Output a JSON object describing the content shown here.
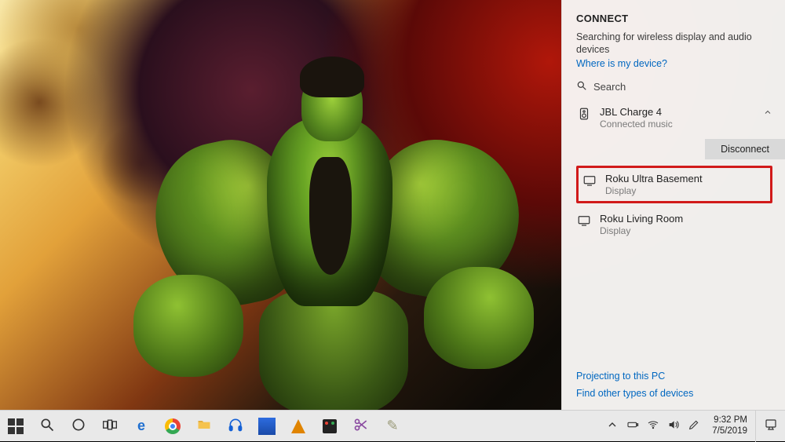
{
  "connect": {
    "title": "CONNECT",
    "status": "Searching for wireless display and audio devices",
    "where_link": "Where is my device?",
    "search_placeholder": "Search",
    "disconnect_label": "Disconnect",
    "devices": [
      {
        "name": "JBL Charge 4",
        "sub": "Connected music",
        "icon": "speaker",
        "expanded": true
      },
      {
        "name": "Roku Ultra Basement",
        "sub": "Display",
        "icon": "display",
        "highlighted": true
      },
      {
        "name": "Roku Living Room",
        "sub": "Display",
        "icon": "display"
      }
    ],
    "footer_links": [
      "Projecting to this PC",
      "Find other types of devices"
    ]
  },
  "taskbar": {
    "left": [
      {
        "name": "start-button",
        "icon": "windows"
      },
      {
        "name": "search-button",
        "icon": "search"
      },
      {
        "name": "cortana-button",
        "icon": "cortana"
      },
      {
        "name": "task-view-button",
        "icon": "taskview"
      },
      {
        "name": "edge-app",
        "icon": "edge"
      },
      {
        "name": "chrome-app",
        "icon": "chrome"
      },
      {
        "name": "explorer-app",
        "icon": "folder"
      },
      {
        "name": "audio-app",
        "icon": "headphones"
      },
      {
        "name": "active-app",
        "icon": "bluewin"
      },
      {
        "name": "vlc-app",
        "icon": "vlc"
      },
      {
        "name": "store-app",
        "icon": "store"
      },
      {
        "name": "snip-app",
        "icon": "snip"
      },
      {
        "name": "misc-app",
        "icon": "misc"
      }
    ],
    "tray": [
      {
        "name": "tray-overflow",
        "icon": "chev-up"
      },
      {
        "name": "battery-icon",
        "icon": "battery"
      },
      {
        "name": "wifi-icon",
        "icon": "wifi"
      },
      {
        "name": "volume-icon",
        "icon": "volume"
      },
      {
        "name": "pen-icon",
        "icon": "pen"
      }
    ],
    "time": "9:32 PM",
    "date": "7/5/2019"
  }
}
